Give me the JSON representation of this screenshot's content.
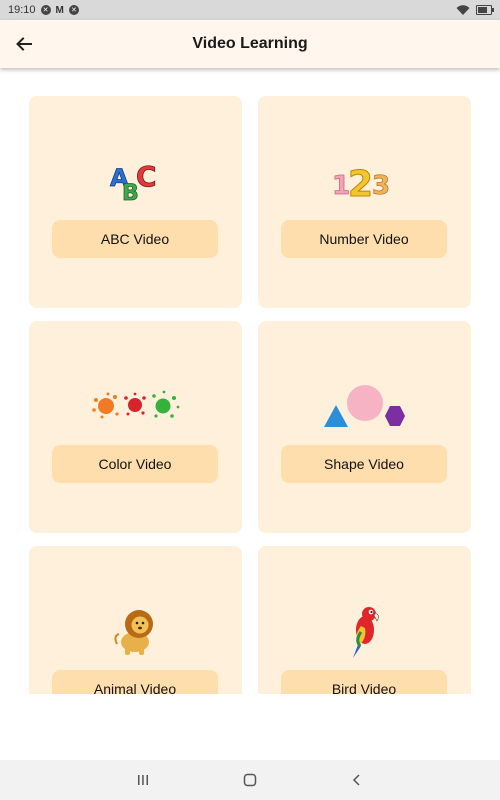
{
  "status_bar": {
    "time": "19:10",
    "notification_icons": [
      "notification-icon",
      "m-icon",
      "notification-icon"
    ]
  },
  "app_bar": {
    "title": "Video Learning",
    "back_icon": "arrow-left-icon"
  },
  "cards": [
    {
      "label": "ABC Video",
      "icon": "abc-blocks-icon"
    },
    {
      "label": "Number Video",
      "icon": "numbers-123-icon"
    },
    {
      "label": "Color Video",
      "icon": "paint-splash-icon"
    },
    {
      "label": "Shape Video",
      "icon": "shapes-icon"
    },
    {
      "label": "Animal Video",
      "icon": "lion-icon"
    },
    {
      "label": "Bird Video",
      "icon": "parrot-icon"
    }
  ],
  "nav_bar": {
    "icons": [
      "recent-apps-icon",
      "home-icon",
      "back-icon"
    ]
  },
  "colors": {
    "card_bg": "#fff0dc",
    "button_bg": "#ffdeae",
    "app_bar_bg": "#fff6ed"
  }
}
